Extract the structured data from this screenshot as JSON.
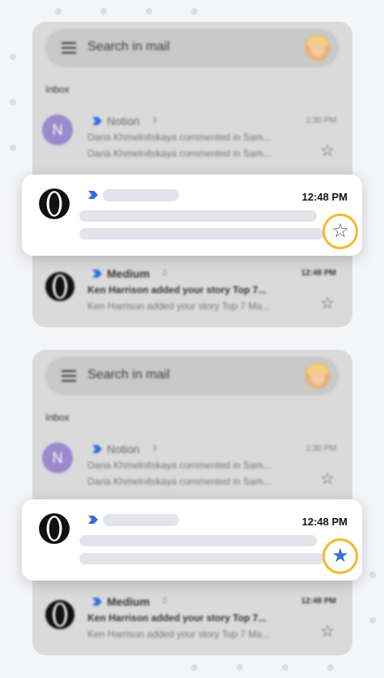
{
  "panels": [
    {
      "search": {
        "placeholder": "Search in mail"
      },
      "section_label": "Inbox",
      "rows": [
        {
          "avatar_letter": "N",
          "sender": "Notion",
          "count": "3",
          "time": "1:30 PM",
          "line1": "Daria Khmelnitskaya commented in Sam...",
          "line2": "Daria Khmelnitskaya commented in Sam..."
        },
        {
          "sender": "Medium",
          "count": "2",
          "time": "12:48 PM",
          "line1": "Ken Harrison added your story Top 7...",
          "line2": "Ken Harrison added your story Top 7 Ma..."
        }
      ],
      "highlight": {
        "time": "12:48 PM",
        "starred": false,
        "star_glyph": "☆"
      }
    },
    {
      "search": {
        "placeholder": "Search in mail"
      },
      "section_label": "Inbox",
      "rows": [
        {
          "avatar_letter": "N",
          "sender": "Notion",
          "count": "3",
          "time": "1:30 PM",
          "line1": "Daria Khmelnitskaya commented in Sam...",
          "line2": "Daria Khmelnitskaya commented in Sam..."
        },
        {
          "sender": "Medium",
          "count": "2",
          "time": "12:48 PM",
          "line1": "Ken Harrison added your story Top 7...",
          "line2": "Ken Harrison added your story Top 7 Ma..."
        }
      ],
      "highlight": {
        "time": "12:48 PM",
        "starred": true,
        "star_glyph": "★"
      }
    }
  ],
  "icons": {
    "menu": "hamburger-menu-icon",
    "star_empty": "☆",
    "star_filled": "★",
    "importance": "importance-marker-icon"
  },
  "colors": {
    "star_ring": "#f4b82c",
    "star_filled": "#3b6fd6",
    "importance_marker": "#2f6fe0",
    "notion_avatar": "#9a8acb"
  }
}
